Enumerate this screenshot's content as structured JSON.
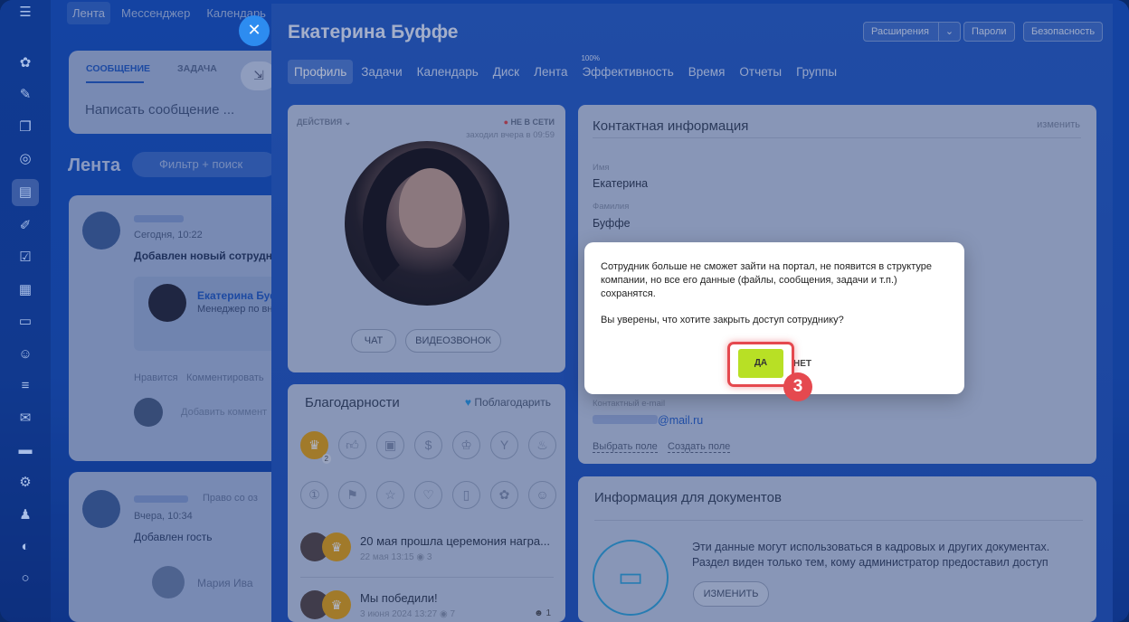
{
  "topnav": {
    "items": [
      "Лента",
      "Мессенджер",
      "Календарь"
    ]
  },
  "feed": {
    "compose_tabs": [
      "СООБЩЕНИЕ",
      "ЗАДАЧА"
    ],
    "compose_placeholder": "Написать сообщение ...",
    "title": "Лента",
    "filter_placeholder": "Фильтр + поиск",
    "post1_time": "Сегодня, 10:22",
    "post1_text": "Добавлен новый сотрудни",
    "post1_employee_name": "Екатерина Буф",
    "post1_employee_role": "Менеджер по вн",
    "post1_like": "Нравится",
    "post1_comment": "Комментировать",
    "post1_add_comment": "Добавить коммент",
    "post2_text1": "Право со оз",
    "post2_time": "Вчера, 10:34",
    "post2_text2": "Добавлен гость",
    "post2_name": "Мария Ива"
  },
  "profile": {
    "name": "Екатерина Буффе",
    "header_buttons": {
      "extensions": "Расширения",
      "passwords": "Пароли",
      "security": "Безопасность"
    },
    "tabs": [
      "Профиль",
      "Задачи",
      "Календарь",
      "Диск",
      "Лента",
      "Эффективность",
      "Время",
      "Отчеты",
      "Группы"
    ],
    "efficiency_badge": "100%",
    "actions_label": "ДЕЙСТВИЯ",
    "status": "НЕ В СЕТИ",
    "last_seen": "заходил вчера в 09:59",
    "chat_button": "ЧАТ",
    "video_button": "ВИДЕОЗВОНОК"
  },
  "thanks": {
    "title": "Благодарности",
    "thank_button": "Поблагодарить",
    "badge_count": "2",
    "feed": [
      {
        "text": "20 мая прошла церемония награ...",
        "date": "22 мая 13:15",
        "views": "3"
      },
      {
        "text": "Мы победили!",
        "date": "3 июня 2024 13:27",
        "views": "7",
        "reactions": "1"
      }
    ]
  },
  "contact": {
    "title": "Контактная информация",
    "edit": "изменить",
    "first_name_label": "Имя",
    "first_name": "Екатерина",
    "last_name_label": "Фамилия",
    "last_name": "Буффе",
    "email_label": "Контактный e-mail",
    "email_domain": "@mail.ru",
    "choose_field": "Выбрать поле",
    "create_field": "Создать поле"
  },
  "docs": {
    "title": "Информация для документов",
    "text": "Эти данные могут использоваться в кадровых и других документах. Раздел виден только тем, кому администратор предоставил доступ",
    "change_button": "ИЗМЕНИТЬ"
  },
  "dialog": {
    "message": "Сотрудник больше не сможет зайти на портал, не появится в структуре компании, но все его данные (файлы, сообщения, задачи и т.п.) сохранятся.",
    "question": "Вы уверены, что хотите закрыть доступ сотруднику?",
    "yes": "ДА",
    "no": "НЕТ"
  },
  "step_marker": "3",
  "colors": {
    "accent": "#b8e025",
    "highlight": "#e5494f",
    "brand_blue": "#2d8cf0"
  }
}
